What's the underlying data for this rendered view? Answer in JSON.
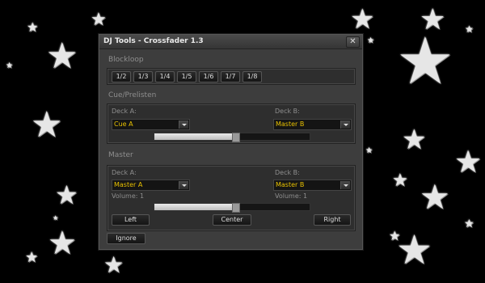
{
  "window": {
    "title": "DJ Tools - Crossfader 1.3",
    "close_label": "✕"
  },
  "blockloop": {
    "label": "Blockloop",
    "buttons": [
      "1/2",
      "1/3",
      "1/4",
      "1/5",
      "1/6",
      "1/7",
      "1/8"
    ]
  },
  "cue": {
    "label": "Cue/Prelisten",
    "deck_a_label": "Deck A:",
    "deck_a_value": "Cue A",
    "deck_b_label": "Deck B:",
    "deck_b_value": "Master B",
    "fader_level": 0.52
  },
  "master": {
    "label": "Master",
    "deck_a_label": "Deck A:",
    "deck_a_value": "Master A",
    "deck_a_volume": "Volume: 1",
    "deck_b_label": "Deck B:",
    "deck_b_value": "Master B",
    "deck_b_volume": "Volume: 1",
    "fader_level": 0.52,
    "left_label": "Left",
    "center_label": "Center",
    "right_label": "Right"
  },
  "footer": {
    "ignore_label": "Ignore"
  },
  "colors": {
    "background": "#000000",
    "window": "#3d3d3d",
    "dropdown_text": "#e8c100",
    "star": "#e6e6e6"
  }
}
